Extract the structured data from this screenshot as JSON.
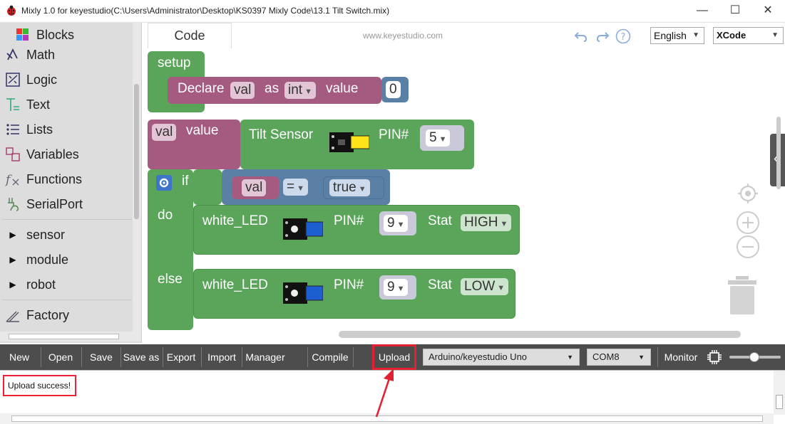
{
  "window": {
    "title": "Mixly 1.0 for keyestudio(C:\\Users\\Administrator\\Desktop\\KS0397 Mixly Code\\13.1 Tilt Switch.mix)",
    "minimize": "—",
    "maximize": "☐",
    "close": "✕"
  },
  "sidebar": {
    "header": "Blocks",
    "items": [
      {
        "label": "Math",
        "icon": "math-icon"
      },
      {
        "label": "Logic",
        "icon": "logic-icon"
      },
      {
        "label": "Text",
        "icon": "text-icon"
      },
      {
        "label": "Lists",
        "icon": "lists-icon"
      },
      {
        "label": "Variables",
        "icon": "variables-icon"
      },
      {
        "label": "Functions",
        "icon": "functions-icon"
      },
      {
        "label": "SerialPort",
        "icon": "serialport-icon"
      },
      {
        "label": "sensor",
        "icon": "expand-triangle-icon"
      },
      {
        "label": "module",
        "icon": "expand-triangle-icon"
      },
      {
        "label": "robot",
        "icon": "expand-triangle-icon"
      },
      {
        "label": "Factory",
        "icon": "factory-icon"
      }
    ]
  },
  "workspace": {
    "tab": "Code",
    "site": "www.keyestudio.com",
    "language": "English",
    "theme": "XCode"
  },
  "blocks": {
    "setup": "setup",
    "declare": "Declare",
    "declare_var": "val",
    "as": "as",
    "type": "int",
    "value": "value",
    "declare_value": "0",
    "assign_var": "val",
    "assign_value": "value",
    "tilt_sensor": "Tilt Sensor",
    "pin_label": "PIN#",
    "tilt_pin": "5",
    "if": "if",
    "cond_var": "val",
    "cond_op": "=",
    "cond_val": "true",
    "do": "do",
    "else": "else",
    "led1": "white_LED",
    "led1_pin": "9",
    "stat": "Stat",
    "led1_stat": "HIGH",
    "led2": "white_LED",
    "led2_pin": "9",
    "led2_stat": "LOW"
  },
  "toolbar": {
    "new": "New",
    "open": "Open",
    "save": "Save",
    "save_as": "Save as",
    "export": "Export",
    "import": "Import",
    "manager": "Manager",
    "compile": "Compile",
    "upload": "Upload",
    "board": "Arduino/keyestudio Uno",
    "port": "COM8",
    "monitor": "Monitor"
  },
  "console": {
    "message": "Upload success!"
  },
  "colors": {
    "logic_block": "#5b80a5",
    "control_block": "#5ba55b",
    "variable_block": "#a55b80",
    "toolbar": "#4d4d4d",
    "highlight": "#e22233"
  }
}
